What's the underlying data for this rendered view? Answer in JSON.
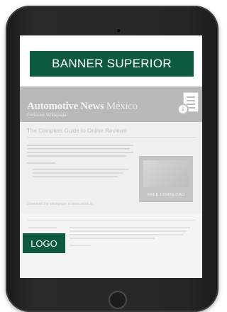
{
  "banner": {
    "label": "BANNER SUPERIOR"
  },
  "masthead": {
    "brand_main": "Automotive News",
    "brand_country": "México",
    "brand_sub": "Exclusive Whitepaper",
    "icon": "document-download-icon"
  },
  "article": {
    "title": "The Complete Guide to Online Reviews",
    "promo_button": "FREE DOWNLOAD",
    "download_note": "Download the whitepaper to learn more in:"
  },
  "footer": {
    "logo_label": "LOGO"
  },
  "colors": {
    "brand_green": "#0c5b3e",
    "device_black": "#222222"
  }
}
